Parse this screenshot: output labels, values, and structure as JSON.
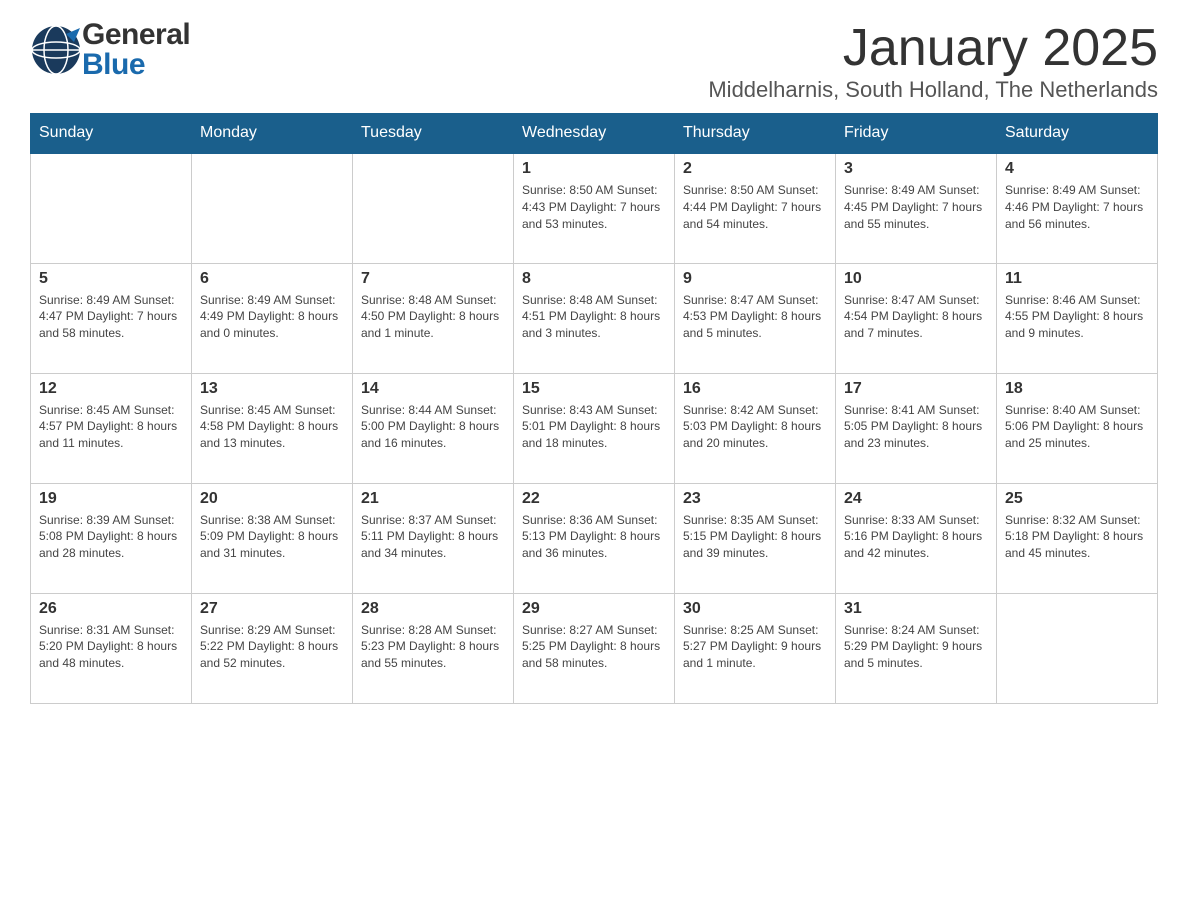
{
  "header": {
    "logo_general": "General",
    "logo_blue": "Blue",
    "month_title": "January 2025",
    "location": "Middelharnis, South Holland, The Netherlands"
  },
  "calendar": {
    "days_of_week": [
      "Sunday",
      "Monday",
      "Tuesday",
      "Wednesday",
      "Thursday",
      "Friday",
      "Saturday"
    ],
    "weeks": [
      [
        {
          "day": "",
          "info": ""
        },
        {
          "day": "",
          "info": ""
        },
        {
          "day": "",
          "info": ""
        },
        {
          "day": "1",
          "info": "Sunrise: 8:50 AM\nSunset: 4:43 PM\nDaylight: 7 hours\nand 53 minutes."
        },
        {
          "day": "2",
          "info": "Sunrise: 8:50 AM\nSunset: 4:44 PM\nDaylight: 7 hours\nand 54 minutes."
        },
        {
          "day": "3",
          "info": "Sunrise: 8:49 AM\nSunset: 4:45 PM\nDaylight: 7 hours\nand 55 minutes."
        },
        {
          "day": "4",
          "info": "Sunrise: 8:49 AM\nSunset: 4:46 PM\nDaylight: 7 hours\nand 56 minutes."
        }
      ],
      [
        {
          "day": "5",
          "info": "Sunrise: 8:49 AM\nSunset: 4:47 PM\nDaylight: 7 hours\nand 58 minutes."
        },
        {
          "day": "6",
          "info": "Sunrise: 8:49 AM\nSunset: 4:49 PM\nDaylight: 8 hours\nand 0 minutes."
        },
        {
          "day": "7",
          "info": "Sunrise: 8:48 AM\nSunset: 4:50 PM\nDaylight: 8 hours\nand 1 minute."
        },
        {
          "day": "8",
          "info": "Sunrise: 8:48 AM\nSunset: 4:51 PM\nDaylight: 8 hours\nand 3 minutes."
        },
        {
          "day": "9",
          "info": "Sunrise: 8:47 AM\nSunset: 4:53 PM\nDaylight: 8 hours\nand 5 minutes."
        },
        {
          "day": "10",
          "info": "Sunrise: 8:47 AM\nSunset: 4:54 PM\nDaylight: 8 hours\nand 7 minutes."
        },
        {
          "day": "11",
          "info": "Sunrise: 8:46 AM\nSunset: 4:55 PM\nDaylight: 8 hours\nand 9 minutes."
        }
      ],
      [
        {
          "day": "12",
          "info": "Sunrise: 8:45 AM\nSunset: 4:57 PM\nDaylight: 8 hours\nand 11 minutes."
        },
        {
          "day": "13",
          "info": "Sunrise: 8:45 AM\nSunset: 4:58 PM\nDaylight: 8 hours\nand 13 minutes."
        },
        {
          "day": "14",
          "info": "Sunrise: 8:44 AM\nSunset: 5:00 PM\nDaylight: 8 hours\nand 16 minutes."
        },
        {
          "day": "15",
          "info": "Sunrise: 8:43 AM\nSunset: 5:01 PM\nDaylight: 8 hours\nand 18 minutes."
        },
        {
          "day": "16",
          "info": "Sunrise: 8:42 AM\nSunset: 5:03 PM\nDaylight: 8 hours\nand 20 minutes."
        },
        {
          "day": "17",
          "info": "Sunrise: 8:41 AM\nSunset: 5:05 PM\nDaylight: 8 hours\nand 23 minutes."
        },
        {
          "day": "18",
          "info": "Sunrise: 8:40 AM\nSunset: 5:06 PM\nDaylight: 8 hours\nand 25 minutes."
        }
      ],
      [
        {
          "day": "19",
          "info": "Sunrise: 8:39 AM\nSunset: 5:08 PM\nDaylight: 8 hours\nand 28 minutes."
        },
        {
          "day": "20",
          "info": "Sunrise: 8:38 AM\nSunset: 5:09 PM\nDaylight: 8 hours\nand 31 minutes."
        },
        {
          "day": "21",
          "info": "Sunrise: 8:37 AM\nSunset: 5:11 PM\nDaylight: 8 hours\nand 34 minutes."
        },
        {
          "day": "22",
          "info": "Sunrise: 8:36 AM\nSunset: 5:13 PM\nDaylight: 8 hours\nand 36 minutes."
        },
        {
          "day": "23",
          "info": "Sunrise: 8:35 AM\nSunset: 5:15 PM\nDaylight: 8 hours\nand 39 minutes."
        },
        {
          "day": "24",
          "info": "Sunrise: 8:33 AM\nSunset: 5:16 PM\nDaylight: 8 hours\nand 42 minutes."
        },
        {
          "day": "25",
          "info": "Sunrise: 8:32 AM\nSunset: 5:18 PM\nDaylight: 8 hours\nand 45 minutes."
        }
      ],
      [
        {
          "day": "26",
          "info": "Sunrise: 8:31 AM\nSunset: 5:20 PM\nDaylight: 8 hours\nand 48 minutes."
        },
        {
          "day": "27",
          "info": "Sunrise: 8:29 AM\nSunset: 5:22 PM\nDaylight: 8 hours\nand 52 minutes."
        },
        {
          "day": "28",
          "info": "Sunrise: 8:28 AM\nSunset: 5:23 PM\nDaylight: 8 hours\nand 55 minutes."
        },
        {
          "day": "29",
          "info": "Sunrise: 8:27 AM\nSunset: 5:25 PM\nDaylight: 8 hours\nand 58 minutes."
        },
        {
          "day": "30",
          "info": "Sunrise: 8:25 AM\nSunset: 5:27 PM\nDaylight: 9 hours\nand 1 minute."
        },
        {
          "day": "31",
          "info": "Sunrise: 8:24 AM\nSunset: 5:29 PM\nDaylight: 9 hours\nand 5 minutes."
        },
        {
          "day": "",
          "info": ""
        }
      ]
    ]
  }
}
